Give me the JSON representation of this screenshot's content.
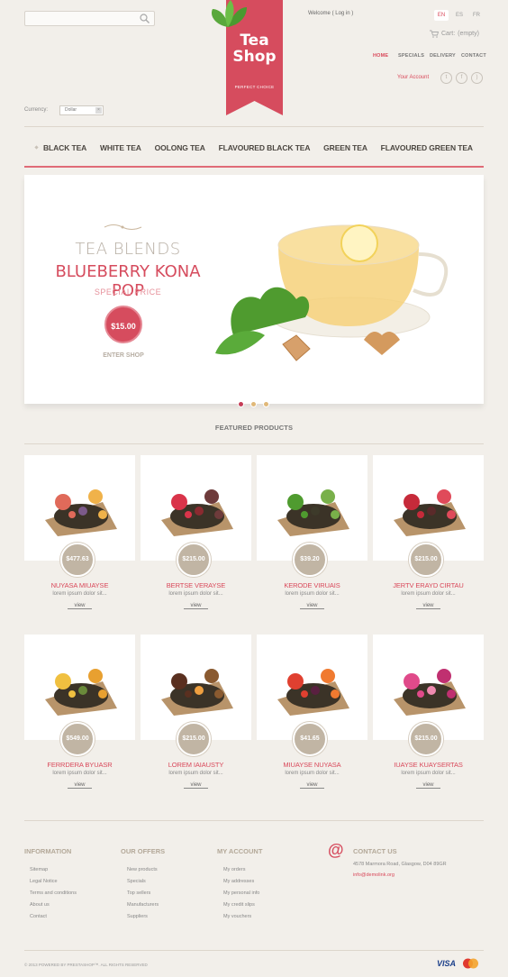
{
  "header": {
    "search_placeholder": "",
    "welcome_prefix": "Welcome ( ",
    "login_label": "Log in",
    "welcome_suffix": " )",
    "languages": [
      "EN",
      "ES",
      "FR"
    ],
    "active_language": "EN",
    "cart_label": "Cart:",
    "cart_value": "(empty)",
    "top_nav": [
      "HOME",
      "SPECIALS",
      "DELIVERY",
      "CONTACT"
    ],
    "your_account": "Your Account",
    "social_icons": [
      "twitter-icon",
      "facebook-icon",
      "rss-icon"
    ],
    "currency_label": "Currency:",
    "currency_value": "Dollar"
  },
  "logo": {
    "line1": "Tea",
    "line2": "Shop",
    "tagline": "PERFECT CHOICE"
  },
  "menu": [
    "BLACK TEA",
    "WHITE TEA",
    "OOLONG TEA",
    "FLAVOURED BLACK TEA",
    "GREEN TEA",
    "FLAVOURED GREEN TEA"
  ],
  "slider": {
    "pre_title": "TEA BLENDS",
    "title": "BLUEBERRY KONA POP",
    "subtitle": "SPECIAL PRICE",
    "price": "$15.00",
    "cta": "ENTER SHOP",
    "dots": 3,
    "active_dot": 0
  },
  "featured": {
    "title": "FEATURED PRODUCTS",
    "products": [
      {
        "name": "NUYASA MIUAYSE",
        "price": "$477.63",
        "desc": "lorem ipsum dolor sit...",
        "view": "view"
      },
      {
        "name": "BERTSE VERAYSE",
        "price": "$215.00",
        "desc": "lorem ipsum dolor sit...",
        "view": "view"
      },
      {
        "name": "KERODE VIRUAIS",
        "price": "$39.20",
        "desc": "lorem ipsum dolor sit...",
        "view": "view"
      },
      {
        "name": "JERTV ERAYD CIRTAU",
        "price": "$215.00",
        "desc": "lorem ipsum dolor sit...",
        "view": "view"
      },
      {
        "name": "FERRDERA BYUASR",
        "price": "$549.00",
        "desc": "lorem ipsum dolor sit...",
        "view": "view"
      },
      {
        "name": "LOREM IAIAUSTY",
        "price": "$215.00",
        "desc": "lorem ipsum dolor sit...",
        "view": "view"
      },
      {
        "name": "MIUAYSE NUYASA",
        "price": "$41.65",
        "desc": "lorem ipsum dolor sit...",
        "view": "view"
      },
      {
        "name": "IUAYSE KUAYSERTAS",
        "price": "$215.00",
        "desc": "lorem ipsum dolor sit...",
        "view": "view"
      }
    ]
  },
  "footer": {
    "information": {
      "title": "INFORMATION",
      "links": [
        "Sitemap",
        "Legal Notice",
        "Terms and conditions",
        "About us",
        "Contact"
      ]
    },
    "offers": {
      "title": "OUR OFFERS",
      "links": [
        "New products",
        "Specials",
        "Top sellers",
        "Manufacturers",
        "Suppliers"
      ]
    },
    "account": {
      "title": "MY ACCOUNT",
      "links": [
        "My orders",
        "My addresses",
        "My personal info",
        "My credit slips",
        "My vouchers"
      ]
    },
    "contact": {
      "title": "CONTACT US",
      "address": "4578 Marmora Road, Glasgow, D04 89GR",
      "email": "info@demolink.org"
    },
    "copyright": "© 2013 POWERED BY PRESTASHOP™. ALL RIGHTS RESERVED",
    "payment": {
      "visa": "VISA",
      "mastercard": "mastercard-icon"
    }
  },
  "colors": {
    "accent": "#d64c5e",
    "background": "#f2efea",
    "price_badge": "#c1b5a4"
  }
}
